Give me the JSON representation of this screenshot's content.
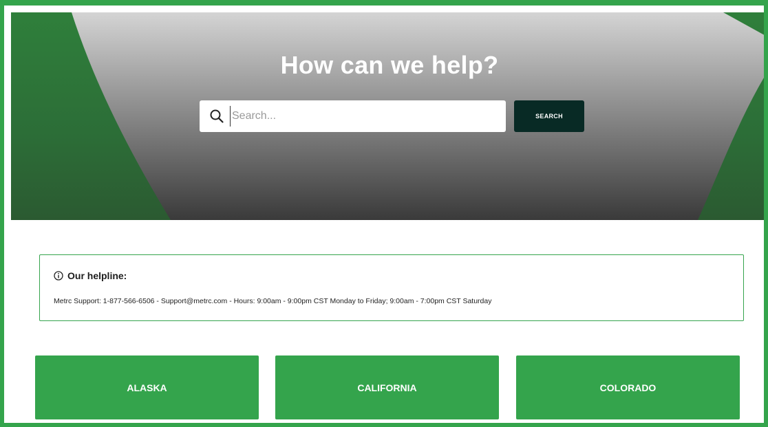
{
  "hero": {
    "title": "How can we help?",
    "search_placeholder": "Search...",
    "search_button_label": "SEARCH",
    "search_icon": "search-icon"
  },
  "helpline": {
    "icon": "info-icon",
    "heading": "Our helpline:",
    "text": "Metrc Support: 1-877-566-6506 - Support@metrc.com - Hours: 9:00am - 9:00pm CST Monday to Friday; 9:00am - 7:00pm CST Saturday"
  },
  "states": [
    {
      "label": "ALASKA"
    },
    {
      "label": "CALIFORNIA"
    },
    {
      "label": "COLORADO"
    }
  ],
  "colors": {
    "accent_green": "#34a44c",
    "hero_green": "#2f7f3b",
    "button_dark": "#082a25",
    "hero_gray": "#cfcfcf"
  }
}
